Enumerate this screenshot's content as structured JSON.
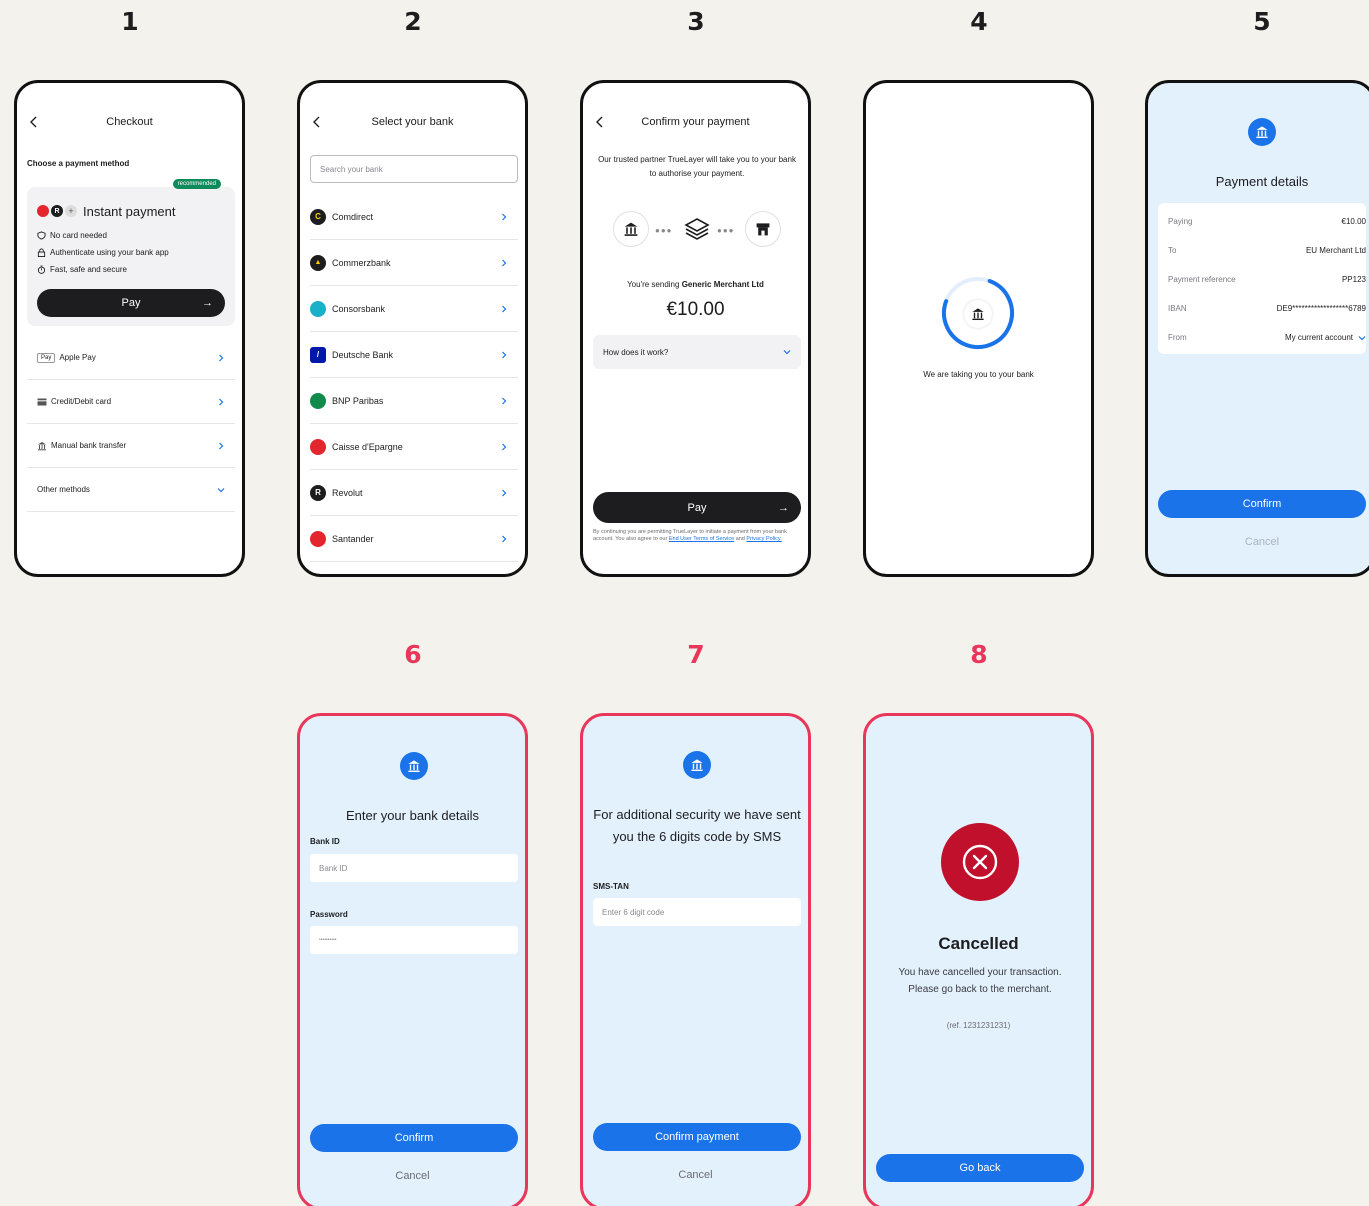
{
  "step_numbers": [
    "1",
    "2",
    "3",
    "4",
    "5",
    "6",
    "7",
    "8"
  ],
  "screen1": {
    "title": "Checkout",
    "subtitle": "Choose a payment method",
    "badge": "recommended",
    "instant_title": "Instant payment",
    "features": [
      "No card needed",
      "Authenticate using your bank app",
      "Fast, safe and secure"
    ],
    "pay_label": "Pay",
    "methods": [
      "Apple Pay",
      "Credit/Debit card",
      "Manual bank transfer",
      "Other methods"
    ],
    "apple_pay_glyph": "Pay"
  },
  "screen2": {
    "title": "Select your bank",
    "search_placeholder": "Search your bank",
    "banks": [
      {
        "name": "Comdirect",
        "color": "#1d1d1f",
        "mark": "C"
      },
      {
        "name": "Commerzbank",
        "color": "#1d1d1f",
        "mark": "▲"
      },
      {
        "name": "Consorsbank",
        "color": "#1ab0c9",
        "mark": ""
      },
      {
        "name": "Deutsche Bank",
        "color": "#0018a8",
        "mark": "/"
      },
      {
        "name": "BNP Paribas",
        "color": "#0f8a4a",
        "mark": ""
      },
      {
        "name": "Caisse d'Epargne",
        "color": "#e3262e",
        "mark": ""
      },
      {
        "name": "Revolut",
        "color": "#1d1d1f",
        "mark": "R"
      },
      {
        "name": "Santander",
        "color": "#e3262e",
        "mark": ""
      }
    ]
  },
  "screen3": {
    "title": "Confirm your payment",
    "intro": "Our trusted partner TrueLayer will take you to your bank to authorise your payment.",
    "sending_prefix": "You're sending",
    "merchant": "Generic Merchant Ltd",
    "amount": "€10.00",
    "how_label": "How does it work?",
    "pay_label": "Pay",
    "legal_prefix": "By continuing you are permitting TrueLayer to initiate a payment from your bank account. You also agree to our",
    "legal_link1": "End User Terms of Service",
    "legal_and": "and",
    "legal_link2": "Privacy Policy."
  },
  "screen4": {
    "loading_text": "We are taking you to your bank",
    "progress": 0.75
  },
  "screen5": {
    "title": "Payment details",
    "rows": [
      {
        "label": "Paying",
        "value": "€10.00"
      },
      {
        "label": "To",
        "value": "EU Merchant Ltd"
      },
      {
        "label": "Payment reference",
        "value": "PP123"
      },
      {
        "label": "IBAN",
        "value": "DE9******************6789"
      },
      {
        "label": "From",
        "value": "My current account"
      }
    ],
    "confirm_label": "Confirm",
    "cancel_label": "Cancel"
  },
  "screen6": {
    "title": "Enter your bank details",
    "bank_id_label": "Bank ID",
    "bank_id_placeholder": "Bank ID",
    "password_label": "Password",
    "password_value": "••••••••••",
    "confirm_label": "Confirm",
    "cancel_label": "Cancel"
  },
  "screen7": {
    "title": "For additional security we have sent you the 6 digits code by SMS",
    "tan_label": "SMS-TAN",
    "tan_placeholder": "Enter 6 digit code",
    "confirm_label": "Confirm payment",
    "cancel_label": "Cancel"
  },
  "screen8": {
    "title": "Cancelled",
    "message": "You have cancelled your transaction. Please go back to the merchant.",
    "ref": "(ref. 1231231231)",
    "button_label": "Go back",
    "error_color": "#c0102c"
  },
  "colors": {
    "accent": "#1a73e8",
    "dark": "#1d1d1f",
    "highlight": "#e8375a",
    "success": "#0f8a5a"
  }
}
